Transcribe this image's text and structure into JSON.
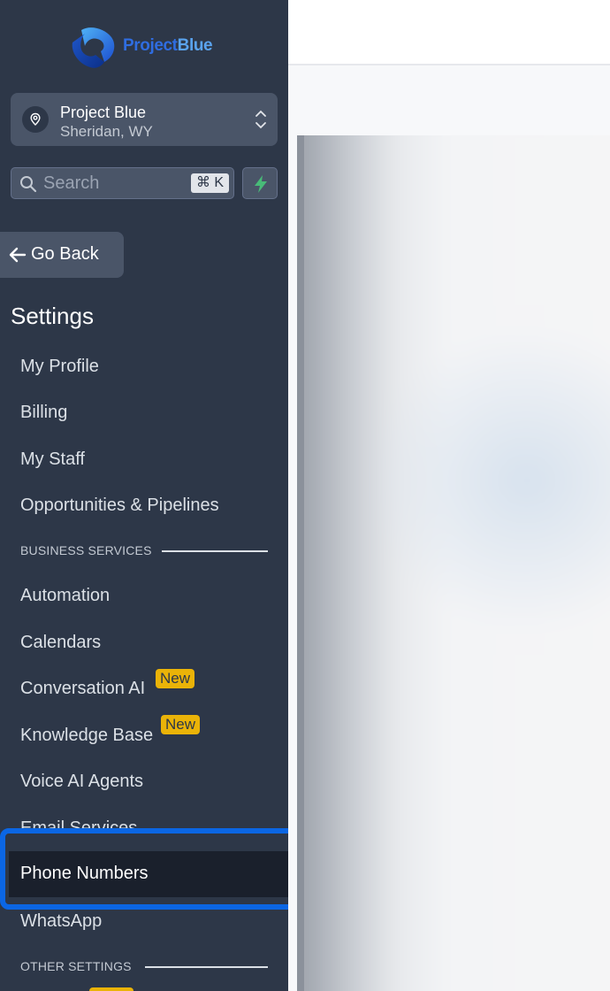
{
  "brand": {
    "name_bold": "Project",
    "name_light": "Blue"
  },
  "account": {
    "name": "Project Blue",
    "location": "Sheridan, WY"
  },
  "search": {
    "placeholder": "Search",
    "shortcut": "⌘ K"
  },
  "go_back_label": "Go Back",
  "settings_title": "Settings",
  "nav": {
    "my_profile": "My Profile",
    "billing": "Billing",
    "my_staff": "My Staff",
    "opportunities": "Opportunities & Pipelines",
    "business_services_header": "BUSINESS SERVICES",
    "automation": "Automation",
    "calendars": "Calendars",
    "conversation_ai": "Conversation AI",
    "knowledge_base": "Knowledge Base",
    "voice_ai_agents": "Voice AI Agents",
    "email_services": "Email Services",
    "phone_numbers": "Phone Numbers",
    "whatsapp": "WhatsApp",
    "other_settings_header": "OTHER SETTINGS",
    "new_badge": "New"
  },
  "colors": {
    "sidebar_bg": "#2d3748",
    "active_bg": "#1a202c",
    "highlight_border": "#0b66e4",
    "badge_bg": "#eab308",
    "bolt_green": "#48bb78"
  }
}
